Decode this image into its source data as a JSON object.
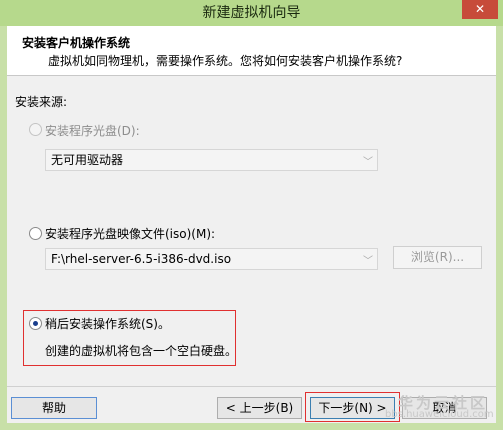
{
  "window": {
    "title": "新建虚拟机向导",
    "close_glyph": "✕"
  },
  "header": {
    "title": "安装客户机操作系统",
    "subtitle": "虚拟机如同物理机，需要操作系统。您将如何安装客户机操作系统?"
  },
  "source": {
    "section_label": "安装来源:",
    "disc": {
      "label": "安装程序光盘(D):",
      "selected": false,
      "enabled": false,
      "dropdown_value": "无可用驱动器"
    },
    "iso": {
      "label": "安装程序光盘映像文件(iso)(M):",
      "selected": false,
      "path_value": "F:\\rhel-server-6.5-i386-dvd.iso",
      "browse_label": "浏览(R)..."
    },
    "later": {
      "label": "稍后安装操作系统(S)。",
      "selected": true,
      "description": "创建的虚拟机将包含一个空白硬盘。"
    }
  },
  "footer": {
    "help_label": "帮助",
    "back_label": "< 上一步(B)",
    "next_label": "下一步(N) >",
    "cancel_label": "取消"
  },
  "watermark": {
    "text": "华为云社区",
    "url": "bbs.huaweicloud.com"
  }
}
